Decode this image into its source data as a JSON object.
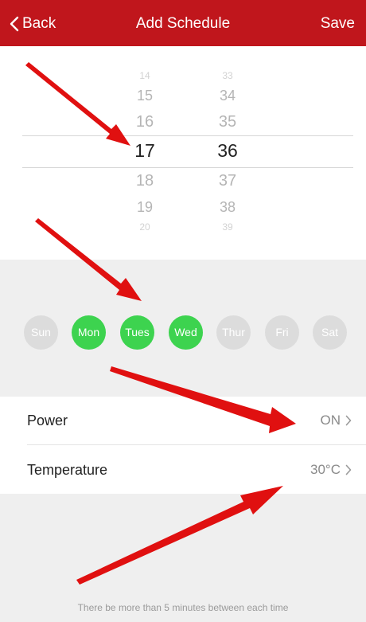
{
  "nav": {
    "back_label": "Back",
    "title": "Add Schedule",
    "save_label": "Save"
  },
  "picker": {
    "hours": [
      "14",
      "15",
      "16",
      "17",
      "18",
      "19",
      "20"
    ],
    "minutes": [
      "33",
      "34",
      "35",
      "36",
      "37",
      "38",
      "39"
    ],
    "selected_hour": "17",
    "selected_minute": "36"
  },
  "days": [
    {
      "label": "Sun",
      "selected": false
    },
    {
      "label": "Mon",
      "selected": true
    },
    {
      "label": "Tues",
      "selected": true
    },
    {
      "label": "Wed",
      "selected": true
    },
    {
      "label": "Thur",
      "selected": false
    },
    {
      "label": "Fri",
      "selected": false
    },
    {
      "label": "Sat",
      "selected": false
    }
  ],
  "settings": {
    "power_label": "Power",
    "power_value": "ON",
    "temperature_label": "Temperature",
    "temperature_value": "30°C"
  },
  "footer_note": "There be more than 5 minutes between each time",
  "colors": {
    "nav_bg": "#c0161c",
    "day_selected": "#3dd34f",
    "day_unselected": "#dcdcdc",
    "annotation_arrow": "#e01010"
  }
}
